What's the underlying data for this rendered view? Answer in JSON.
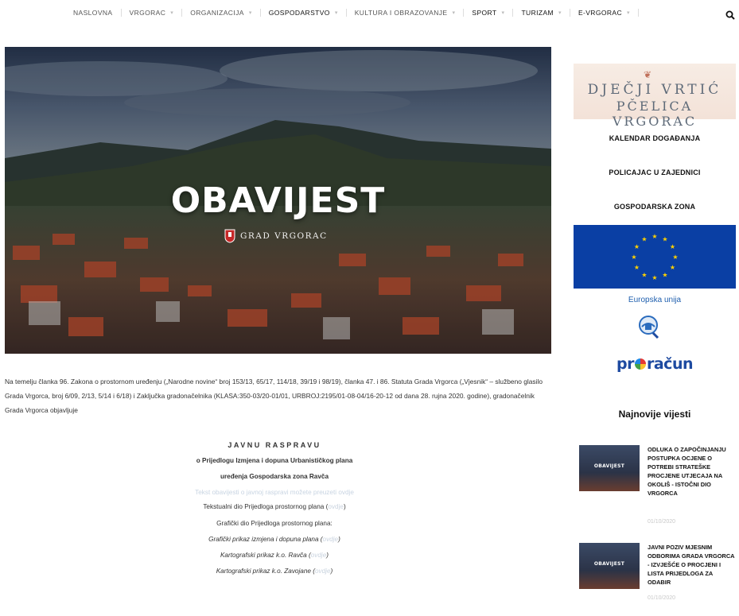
{
  "nav": {
    "items": [
      {
        "label": "NASLOVNA",
        "dropdown": false
      },
      {
        "label": "VRGORAC",
        "dropdown": true
      },
      {
        "label": "ORGANIZACIJA",
        "dropdown": true
      },
      {
        "label": "GOSPODARSTVO",
        "dropdown": true
      },
      {
        "label": "KULTURA I OBRAZOVANJE",
        "dropdown": true
      },
      {
        "label": "SPORT",
        "dropdown": true
      },
      {
        "label": "TURIZAM",
        "dropdown": true
      },
      {
        "label": "E-VRGORAC",
        "dropdown": true
      }
    ],
    "search_icon": "search-icon"
  },
  "hero": {
    "title": "OBAVIJEST",
    "brand": "GRAD VRGORAC"
  },
  "article": {
    "paragraph": "Na temelju članka 96. Zakona o prostornom uređenju („Narodne novine“ broj 153/13, 65/17, 114/18, 39/19 i 98/19), članka 47. i 86. Statuta Grada Vrgorca („Vjesnik“ – službeno glasilo Grada Vrgorca, broj 6/09, 2/13, 5/14 i 6/18) i Zaključka gradonačelnika (KLASA:350-03/20-01/01, URBROJ:2195/01-08-04/16-20-12 od dana 28. rujna 2020. godine), gradonačelnik Grada Vrgorca objavljuje",
    "center": {
      "heading": "JAVNU RASPRAVU",
      "line1": "o Prijedlogu Izmjena i dopuna Urbanističkog plana",
      "line2": "uređenja Gospodarska zona Ravča",
      "faint": "Tekst obavijesti o javnoj raspravi možete preuzeti ovdje",
      "line4_text": "Tekstualni dio Prijedloga prostornog plana (",
      "line4_link": "ovdje",
      "line5": "Grafički dio Prijedloga prostornog plana:",
      "line6_text": "Grafički prikaz izmjena i dopuna plana (",
      "line6_link": "ovdje",
      "line7_text": "Kartografski prikaz k.o. Ravča (",
      "line7_link": "ovdje",
      "line8_text": "Kartografski prikaz k.o. Zavojane (",
      "line8_link": "ovdje"
    }
  },
  "sidebar": {
    "kindergarten_line1": "DJEČJI VRTIĆ",
    "kindergarten_line2": "PČELICA VRGORAC",
    "links": [
      "KALENDAR DOGAĐANJA",
      "POLICAJAC U ZAJEDNICI",
      "GOSPODARSKA ZONA"
    ],
    "eu_label": "Europska unija",
    "proracun_pre": "pr",
    "proracun_post": "račun",
    "news_heading": "Najnovije vijesti",
    "news": [
      {
        "thumb": "OBAVIJEST",
        "title": "ODLUKA O ZAPOČINJANJU POSTUPKA OCJENE O POTREBI STRATEŠKE PROCJENE UTJECAJA NA OKOLIŠ - ISTOČNI DIO VRGORCA",
        "date": "01/10/2020"
      },
      {
        "thumb": "OBAVIJEST",
        "title": "JAVNI POZIV MJESNIM ODBORIMA GRADA VRGORCA - IZVJEŠĆE O PROCJENI I LISTA PRIJEDLOGA ZA ODABIR",
        "date": "01/10/2020"
      }
    ]
  },
  "colors": {
    "eu_blue": "#0a3fa4",
    "eu_star": "#ffd200",
    "link_blue": "#1f5fae"
  }
}
